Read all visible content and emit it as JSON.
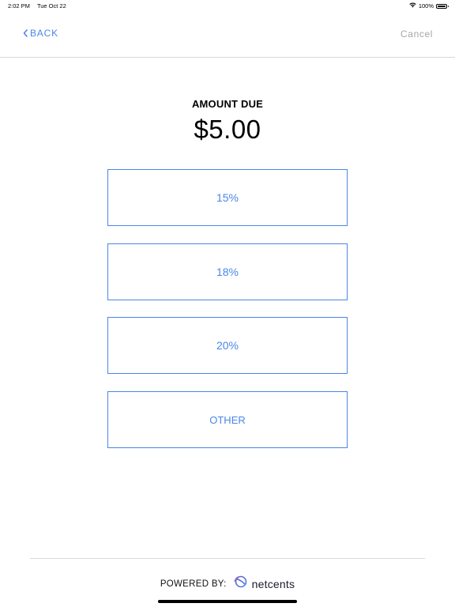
{
  "status_bar": {
    "time": "2:02 PM",
    "date": "Tue Oct 22",
    "battery": "100%",
    "battery_level": 1.0,
    "wifi_icon": "wifi-icon",
    "battery_icon": "battery-icon"
  },
  "nav": {
    "back_label": "BACK",
    "back_icon": "chevron-left-icon",
    "cancel_label": "Cancel"
  },
  "amount": {
    "label": "AMOUNT DUE",
    "value": "$5.00"
  },
  "tip_options": [
    {
      "label": "15%"
    },
    {
      "label": "18%"
    },
    {
      "label": "20%"
    },
    {
      "label": "OTHER"
    }
  ],
  "footer": {
    "powered_by": "POWERED BY:",
    "brand_name": "netcents",
    "brand_icon": "netcents-logo-icon"
  },
  "colors": {
    "accent": "#4a86e8",
    "cancel": "#a6a6a6",
    "divider": "#d8d8d8"
  }
}
